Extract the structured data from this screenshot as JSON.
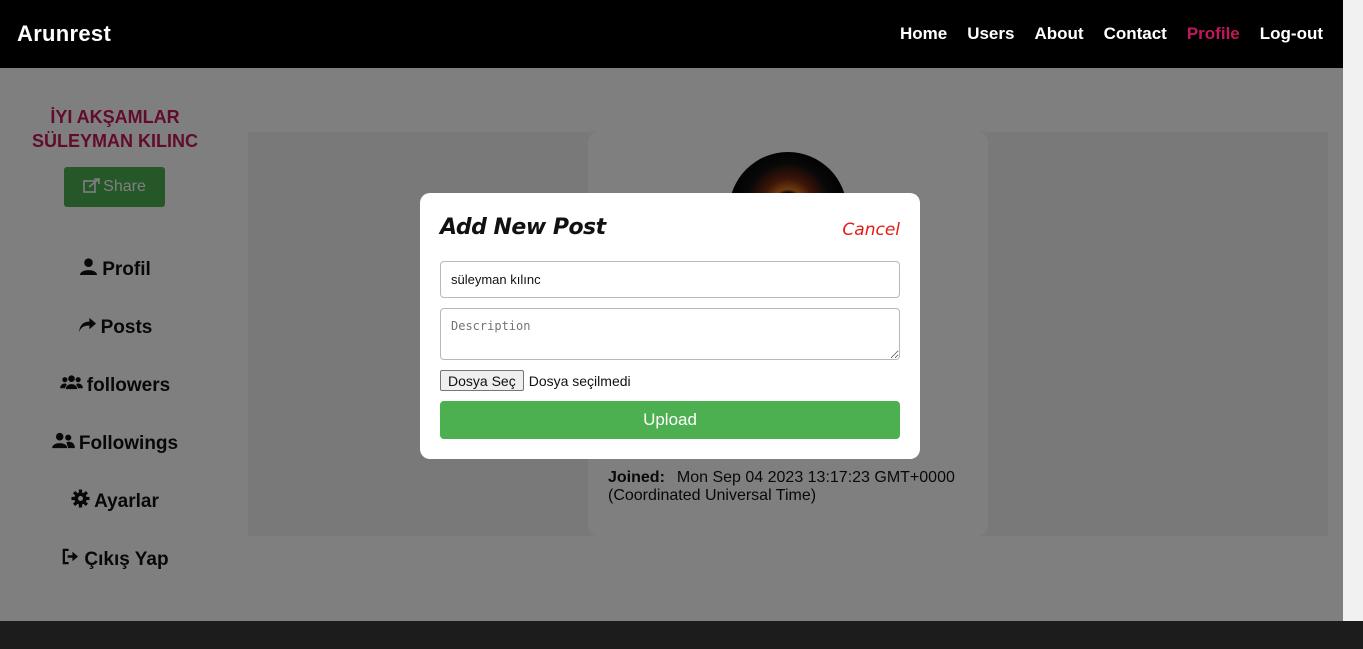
{
  "navbar": {
    "brand": "Arunrest",
    "links": [
      {
        "label": "Home"
      },
      {
        "label": "Users"
      },
      {
        "label": "About"
      },
      {
        "label": "Contact"
      },
      {
        "label": "Profile",
        "active": true
      },
      {
        "label": "Log-out"
      }
    ]
  },
  "sidebar": {
    "greeting_line1": "İYI AKŞAMLAR",
    "greeting_line2": "SÜLEYMAN KILINC",
    "share_label": "Share",
    "items": [
      {
        "label": "Profil",
        "icon": "user-icon"
      },
      {
        "label": "Posts",
        "icon": "share-arrow-icon"
      },
      {
        "label": "followers",
        "icon": "users-group-icon"
      },
      {
        "label": "Followings",
        "icon": "user-friends-icon"
      },
      {
        "label": "Ayarlar",
        "icon": "gear-icon"
      },
      {
        "label": "Çıkış Yap",
        "icon": "sign-out-icon"
      }
    ]
  },
  "profile": {
    "joined_label": "Joined:",
    "joined_value": "Mon Sep 04 2023 13:17:23 GMT+0000 (Coordinated Universal Time)"
  },
  "modal": {
    "title": "Add New Post",
    "cancel_label": "Cancel",
    "title_value": "süleyman kılınc",
    "description_placeholder": "Description",
    "file_button_label": "Dosya Seç",
    "file_status": "Dosya seçilmedi",
    "upload_label": "Upload"
  },
  "colors": {
    "accent": "#c2185b",
    "success": "#4caf50",
    "cancel": "#e31b1b",
    "navbar": "#000000"
  }
}
